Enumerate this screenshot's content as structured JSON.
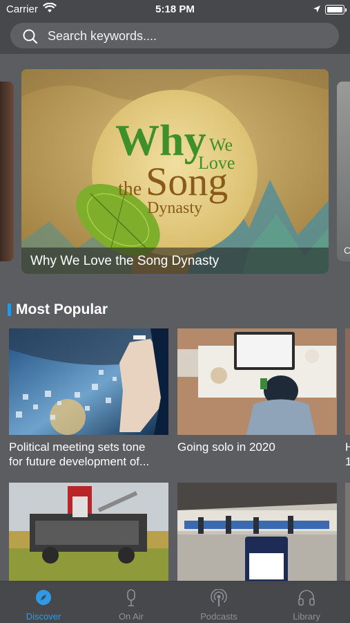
{
  "status_bar": {
    "carrier": "Carrier",
    "time": "5:18 PM"
  },
  "search": {
    "placeholder": "Search keywords...."
  },
  "banner": {
    "caption": "Why We Love the Song Dynasty",
    "art_text": {
      "why": "Why",
      "we": "We",
      "love": "Love",
      "the": "the",
      "song": "Song",
      "dynasty": "Dynasty"
    }
  },
  "next_banner_peek": {
    "letter": "C"
  },
  "section": {
    "title": "Most Popular"
  },
  "cards": [
    {
      "title_line1": "Political meeting sets tone",
      "title_line2": "for future development of..."
    },
    {
      "title_line1": "Going solo in 2020",
      "title_line2": ""
    }
  ],
  "peek_card": {
    "line1": "H",
    "line2": "1"
  },
  "tabs": [
    {
      "label": "Discover",
      "icon": "compass-icon",
      "active": true
    },
    {
      "label": "On Air",
      "icon": "microphone-icon",
      "active": false
    },
    {
      "label": "Podcasts",
      "icon": "podcast-icon",
      "active": false
    },
    {
      "label": "Library",
      "icon": "headphones-icon",
      "active": false
    }
  ],
  "colors": {
    "accent": "#2f9ae8",
    "background": "#5b5d60",
    "bars": "#46484b"
  }
}
